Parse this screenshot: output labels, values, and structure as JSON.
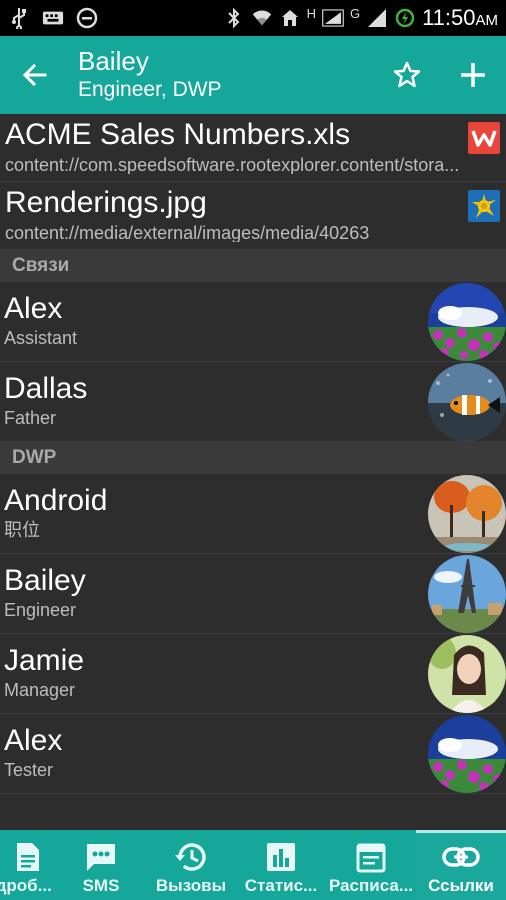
{
  "status_bar": {
    "time": "11:50",
    "ampm": "AM",
    "network_h": "H",
    "network_g": "G"
  },
  "app_bar": {
    "title": "Bailey",
    "subtitle": "Engineer, DWP"
  },
  "files": [
    {
      "name": "ACME Sales Numbers.xls",
      "path": "content://com.speedsoftware.rootexplorer.content/stora...",
      "icon": "wps-office-icon"
    },
    {
      "name": "Renderings.jpg",
      "path": "content://media/external/images/media/40263",
      "icon": "image-thumbnail-icon"
    }
  ],
  "sections": [
    {
      "header": "Связи",
      "contacts": [
        {
          "name": "Alex",
          "role": "Assistant",
          "avatar": "flowers-avatar"
        },
        {
          "name": "Dallas",
          "role": "Father",
          "avatar": "fish-avatar"
        }
      ]
    },
    {
      "header": "DWP",
      "contacts": [
        {
          "name": "Android",
          "role": "职位",
          "avatar": "autumn-trees-avatar"
        },
        {
          "name": "Bailey",
          "role": "Engineer",
          "avatar": "eiffel-tower-avatar"
        },
        {
          "name": "Jamie",
          "role": "Manager",
          "avatar": "portrait-avatar"
        },
        {
          "name": "Alex",
          "role": "Tester",
          "avatar": "flowers-avatar"
        }
      ]
    }
  ],
  "bottom_nav": [
    {
      "label": "ɔдроб...",
      "icon": "document-icon"
    },
    {
      "label": "SMS",
      "icon": "chat-icon"
    },
    {
      "label": "Вызовы",
      "icon": "history-icon"
    },
    {
      "label": "Статис...",
      "icon": "bar-chart-icon"
    },
    {
      "label": "Расписа...",
      "icon": "calendar-icon"
    },
    {
      "label": "Ссылки",
      "icon": "link-icon",
      "active": true
    }
  ],
  "colors": {
    "accent": "#16a79b",
    "background": "#2d2d2d",
    "section": "#3a3a3a"
  }
}
